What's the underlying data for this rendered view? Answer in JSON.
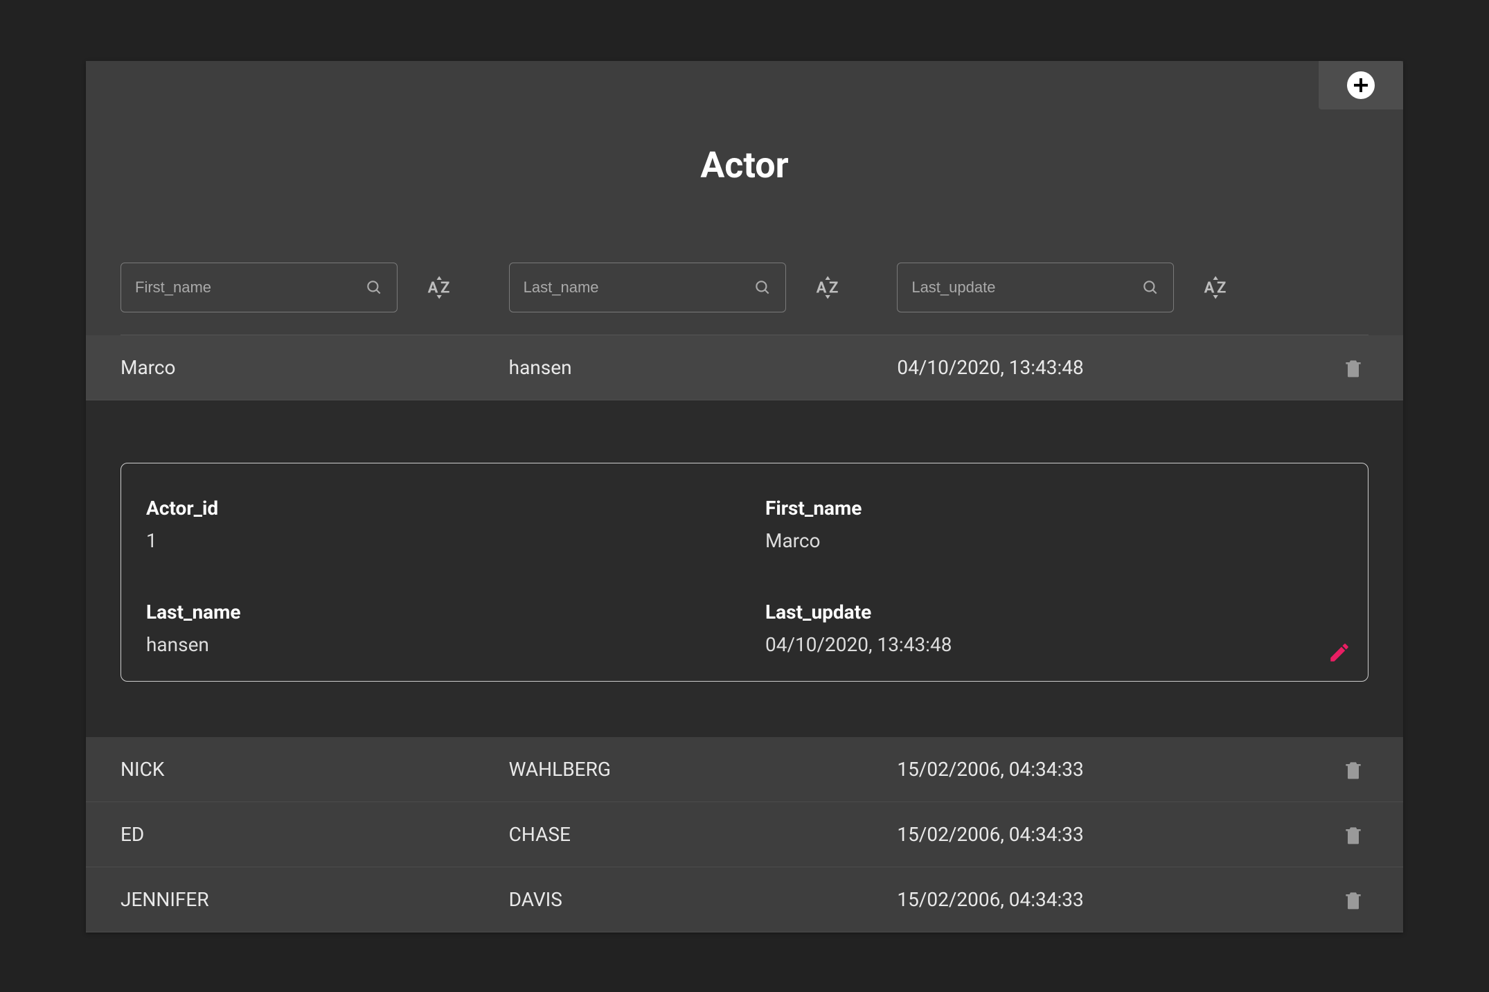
{
  "title": "Actor",
  "filters": {
    "first_name": {
      "placeholder": "First_name"
    },
    "last_name": {
      "placeholder": "Last_name"
    },
    "last_update": {
      "placeholder": "Last_update"
    }
  },
  "colors": {
    "accent": "#e91e63",
    "icon_muted": "#9a9a9a"
  },
  "rows": [
    {
      "first_name": "Marco",
      "last_name": "hansen",
      "last_update": "04/10/2020, 13:43:48"
    },
    {
      "first_name": "NICK",
      "last_name": "WAHLBERG",
      "last_update": "15/02/2006, 04:34:33"
    },
    {
      "first_name": "ED",
      "last_name": "CHASE",
      "last_update": "15/02/2006, 04:34:33"
    },
    {
      "first_name": "JENNIFER",
      "last_name": "DAVIS",
      "last_update": "15/02/2006, 04:34:33"
    }
  ],
  "detail": {
    "labels": {
      "actor_id": "Actor_id",
      "first_name": "First_name",
      "last_name": "Last_name",
      "last_update": "Last_update"
    },
    "values": {
      "actor_id": "1",
      "first_name": "Marco",
      "last_name": "hansen",
      "last_update": "04/10/2020, 13:43:48"
    }
  }
}
